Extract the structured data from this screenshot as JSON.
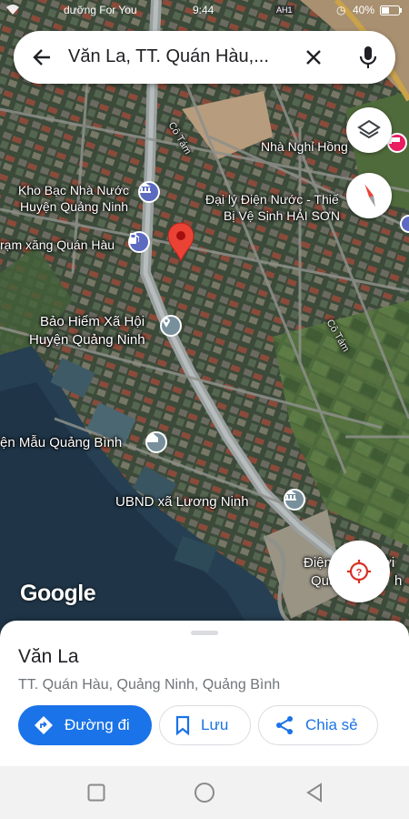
{
  "status_bar": {
    "left_text": "dưỡng For You",
    "time": "9:44",
    "carrier_tag": "AH1",
    "battery": "40%"
  },
  "search": {
    "query": "Văn La, TT. Quán Hàu,...",
    "icons": [
      "arrow-back-icon",
      "close-icon",
      "microphone-icon"
    ]
  },
  "map": {
    "labels": {
      "street_a": "Cô Tám",
      "street_b": "Cô Tám",
      "nha_nghi": "Nhà Nghỉ Hồng",
      "kho_bac_1": "Kho Bạc Nhà Nước",
      "kho_bac_2": "Huyện Quảng Ninh",
      "dai_ly_1": "Đại lý Điện Nước - Thiế",
      "dai_ly_2": "Bị Vệ Sinh HẢI SƠN",
      "tram_xang": "rạm xăng Quán Hàu",
      "bao_hiem_1": "Bảo Hiểm Xã Hội",
      "bao_hiem_2": "Huyện Quảng Ninh",
      "dien_mau": "ện Mẫu Quảng Bình",
      "ubnd": "UBND xã Lương Ninh",
      "dien_luc_1": "Điện",
      "dien_luc_2": "rời",
      "dien_luc_3": "Quả",
      "dien_luc_4": "h"
    },
    "attribution": "Google",
    "accent_pin": "#ea4335",
    "poi_colors": {
      "bank": "#5c6bc0",
      "fuel": "#5c6bc0",
      "generic": "#78909c",
      "government": "#78909c"
    }
  },
  "place": {
    "title": "Văn La",
    "address": "TT. Quán Hàu, Quảng Ninh, Quảng Bình",
    "actions": {
      "directions": "Đường đi",
      "save": "Lưu",
      "share": "Chia sẻ"
    }
  },
  "colors": {
    "primary": "#1a73e8",
    "text": "#202124",
    "secondary_text": "#70757a"
  }
}
